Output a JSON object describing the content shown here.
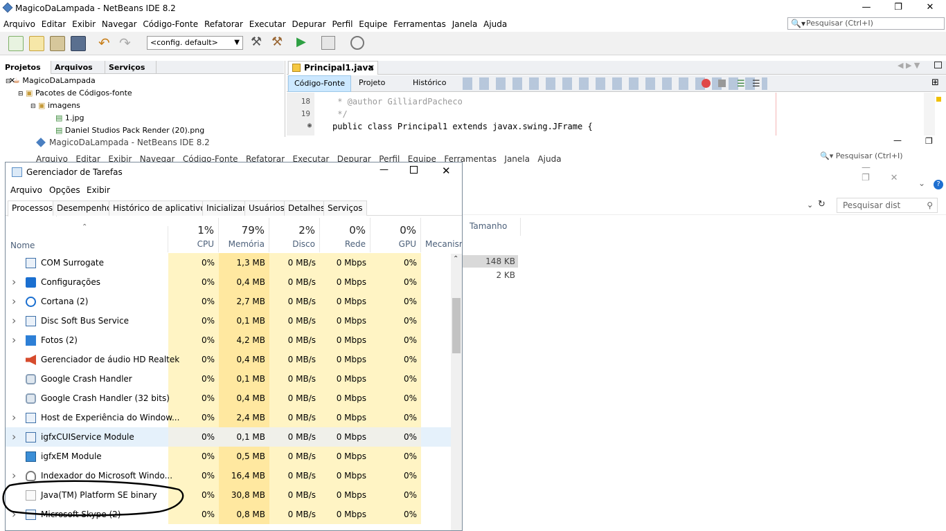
{
  "netbeans": {
    "title": "MagicoDaLampada - NetBeans IDE 8.2",
    "menu": [
      "Arquivo",
      "Editar",
      "Exibir",
      "Navegar",
      "Código-Fonte",
      "Refatorar",
      "Executar",
      "Depurar",
      "Perfil",
      "Equipe",
      "Ferramentas",
      "Janela",
      "Ajuda"
    ],
    "search_placeholder": "Pesquisar (Ctrl+I)",
    "config": "<config. default>",
    "panel_tabs": [
      "Projetos",
      "Arquivos",
      "Serviços"
    ],
    "tree": {
      "project": "MagicoDaLampada",
      "packages": "Pacotes de Códigos-fonte",
      "folder": "imagens",
      "file1": "1.jpg",
      "file2": "Daniel Studios Pack Render (20).png"
    },
    "editor_tab": "Principal1.java",
    "sub_tabs": [
      "Código-Fonte",
      "Projeto",
      "Histórico"
    ],
    "code_lines": [
      {
        "num": "18",
        "text": " * @author GilliardPacheco"
      },
      {
        "num": "19",
        "text": " */"
      },
      {
        "num": "",
        "text": "public class Principal1 extends javax.swing.JFrame {"
      }
    ]
  },
  "ghost_window": {
    "title": "MagicoDaLampada - NetBeans IDE 8.2",
    "menu": "Arquivo   Editar   Exibir   Navegar   Código-Fonte   Refatorar   Executar   Depurar   Perfil   Equipe   Ferramentas   Janela   Ajuda",
    "search_placeholder": "Pesquisar (Ctrl+I)",
    "search2_placeholder": "Pesquisar dist",
    "col_size": "Tamanho",
    "sizes": [
      "148 KB",
      "2 KB"
    ]
  },
  "taskmgr": {
    "title": "Gerenciador de Tarefas",
    "menu": [
      "Arquivo",
      "Opções",
      "Exibir"
    ],
    "tabs": [
      "Processos",
      "Desempenho",
      "Histórico de aplicativos",
      "Inicializar",
      "Usuários",
      "Detalhes",
      "Serviços"
    ],
    "name_header": "Nome",
    "columns": [
      {
        "pct": "1%",
        "label": "CPU"
      },
      {
        "pct": "79%",
        "label": "Memória"
      },
      {
        "pct": "2%",
        "label": "Disco"
      },
      {
        "pct": "0%",
        "label": "Rede"
      },
      {
        "pct": "0%",
        "label": "GPU"
      }
    ],
    "extra_col": "Mecanism",
    "rows": [
      {
        "name": "COM Surrogate",
        "expand": false,
        "icon": "window-icon",
        "cpu": "0%",
        "mem": "1,3 MB",
        "disk": "0 MB/s",
        "net": "0 Mbps",
        "gpu": "0%"
      },
      {
        "name": "Configurações",
        "expand": true,
        "icon": "gear-icon",
        "cpu": "0%",
        "mem": "0,4 MB",
        "disk": "0 MB/s",
        "net": "0 Mbps",
        "gpu": "0%"
      },
      {
        "name": "Cortana (2)",
        "expand": true,
        "icon": "cortana-icon",
        "cpu": "0%",
        "mem": "2,7 MB",
        "disk": "0 MB/s",
        "net": "0 Mbps",
        "gpu": "0%"
      },
      {
        "name": "Disc Soft Bus Service",
        "expand": true,
        "icon": "window-icon",
        "cpu": "0%",
        "mem": "0,1 MB",
        "disk": "0 MB/s",
        "net": "0 Mbps",
        "gpu": "0%"
      },
      {
        "name": "Fotos (2)",
        "expand": true,
        "icon": "photos-icon",
        "cpu": "0%",
        "mem": "4,2 MB",
        "disk": "0 MB/s",
        "net": "0 Mbps",
        "gpu": "0%"
      },
      {
        "name": "Gerenciador de áudio HD Realtek",
        "expand": false,
        "icon": "speaker-icon",
        "cpu": "0%",
        "mem": "0,4 MB",
        "disk": "0 MB/s",
        "net": "0 Mbps",
        "gpu": "0%"
      },
      {
        "name": "Google Crash Handler",
        "expand": false,
        "icon": "google-icon",
        "cpu": "0%",
        "mem": "0,1 MB",
        "disk": "0 MB/s",
        "net": "0 Mbps",
        "gpu": "0%"
      },
      {
        "name": "Google Crash Handler (32 bits)",
        "expand": false,
        "icon": "google-icon",
        "cpu": "0%",
        "mem": "0,4 MB",
        "disk": "0 MB/s",
        "net": "0 Mbps",
        "gpu": "0%"
      },
      {
        "name": "Host de Experiência do Window...",
        "expand": true,
        "icon": "window-icon",
        "cpu": "0%",
        "mem": "2,4 MB",
        "disk": "0 MB/s",
        "net": "0 Mbps",
        "gpu": "0%"
      },
      {
        "name": "igfxCUIService Module",
        "expand": true,
        "icon": "window-icon",
        "cpu": "0%",
        "mem": "0,1 MB",
        "disk": "0 MB/s",
        "net": "0 Mbps",
        "gpu": "0%",
        "selected": true
      },
      {
        "name": "igfxEM Module",
        "expand": false,
        "icon": "intel-icon",
        "cpu": "0%",
        "mem": "0,5 MB",
        "disk": "0 MB/s",
        "net": "0 Mbps",
        "gpu": "0%"
      },
      {
        "name": "Indexador do Microsoft Windo...",
        "expand": true,
        "icon": "indexer-icon",
        "cpu": "0%",
        "mem": "16,4 MB",
        "disk": "0 MB/s",
        "net": "0 Mbps",
        "gpu": "0%"
      },
      {
        "name": "Java(TM) Platform SE binary",
        "expand": false,
        "icon": "java-icon",
        "cpu": "0%",
        "mem": "30,8 MB",
        "disk": "0 MB/s",
        "net": "0 Mbps",
        "gpu": "0%"
      },
      {
        "name": "Microsoft Skype (2)",
        "expand": true,
        "icon": "window-icon",
        "cpu": "0%",
        "mem": "0,8 MB",
        "disk": "0 MB/s",
        "net": "0 Mbps",
        "gpu": "0%"
      }
    ]
  },
  "colors": {
    "highlight_cell": "#fff4c4",
    "highlight_mem": "#ffe8a0",
    "selected_row": "#e5f1fb",
    "tab_accent": "#cce8ff"
  }
}
